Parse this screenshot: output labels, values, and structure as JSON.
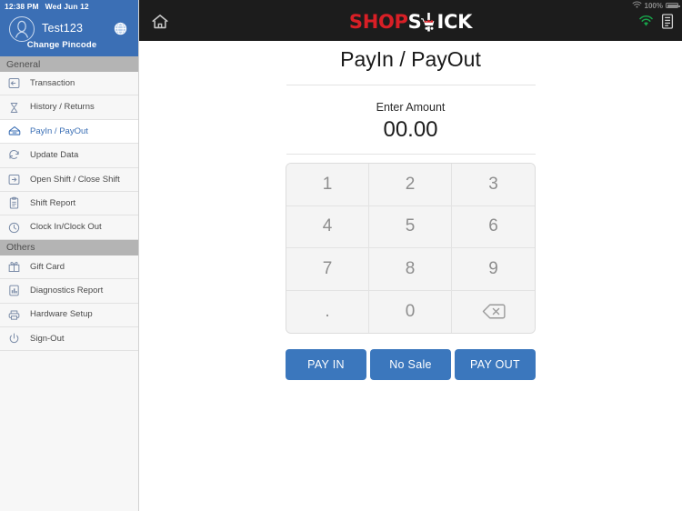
{
  "status_bar": {
    "time": "12:38 PM",
    "date": "Wed Jun 12"
  },
  "device_status": {
    "battery_percent": "100%",
    "wifi_icon": "wifi-icon",
    "battery_icon": "battery-full-icon"
  },
  "sidebar": {
    "account": {
      "name": "Test123",
      "change_pincode_label": "Change Pincode",
      "avatar_icon": "user-avatar-icon",
      "globe_icon": "globe-icon"
    },
    "sections": [
      {
        "header": "General",
        "items": [
          {
            "label": "Transaction",
            "icon": "transaction-arrow-icon",
            "active": false
          },
          {
            "label": "History / Returns",
            "icon": "hourglass-icon",
            "active": false
          },
          {
            "label": "PayIn / PayOut",
            "icon": "cash-drawer-icon",
            "active": true
          },
          {
            "label": "Update Data",
            "icon": "refresh-icon",
            "active": false
          },
          {
            "label": "Open Shift / Close Shift",
            "icon": "login-arrow-icon",
            "active": false
          },
          {
            "label": "Shift Report",
            "icon": "clipboard-icon",
            "active": false
          },
          {
            "label": "Clock In/Clock Out",
            "icon": "clock-icon",
            "active": false
          }
        ]
      },
      {
        "header": "Others",
        "items": [
          {
            "label": "Gift Card",
            "icon": "gift-card-icon",
            "active": false
          },
          {
            "label": "Diagnostics Report",
            "icon": "chart-report-icon",
            "active": false
          },
          {
            "label": "Hardware Setup",
            "icon": "printer-icon",
            "active": false
          },
          {
            "label": "Sign-Out",
            "icon": "power-icon",
            "active": false
          }
        ]
      }
    ]
  },
  "topbar": {
    "home_icon": "home-icon",
    "logo": {
      "part_red": "SHOP",
      "part_white_1": "S",
      "cart_icon": "shopping-cart-icon",
      "part_white_2": "ICK"
    },
    "signal_icon": "wifi-signal-green-icon",
    "receipt_icon": "receipt-icon"
  },
  "main": {
    "title": "PayIn / PayOut",
    "amount_label": "Enter Amount",
    "amount_value": "00.00",
    "keypad": [
      {
        "label": "1",
        "name": "key-1"
      },
      {
        "label": "2",
        "name": "key-2"
      },
      {
        "label": "3",
        "name": "key-3"
      },
      {
        "label": "4",
        "name": "key-4"
      },
      {
        "label": "5",
        "name": "key-5"
      },
      {
        "label": "6",
        "name": "key-6"
      },
      {
        "label": "7",
        "name": "key-7"
      },
      {
        "label": "8",
        "name": "key-8"
      },
      {
        "label": "9",
        "name": "key-9"
      },
      {
        "label": ".",
        "name": "key-decimal"
      },
      {
        "label": "0",
        "name": "key-0"
      },
      {
        "label": "",
        "name": "key-backspace"
      }
    ],
    "buttons": [
      {
        "label": "PAY IN",
        "name": "pay-in-button"
      },
      {
        "label": "No Sale",
        "name": "no-sale-button"
      },
      {
        "label": "PAY OUT",
        "name": "pay-out-button"
      }
    ]
  },
  "colors": {
    "sidebar_accent": "#3b6fb5",
    "button_blue": "#3b77bd",
    "logo_red": "#d81f26",
    "topbar_dark": "#1c1c1c",
    "section_header_gray": "#b4b4b4",
    "signal_green": "#18a24a"
  }
}
